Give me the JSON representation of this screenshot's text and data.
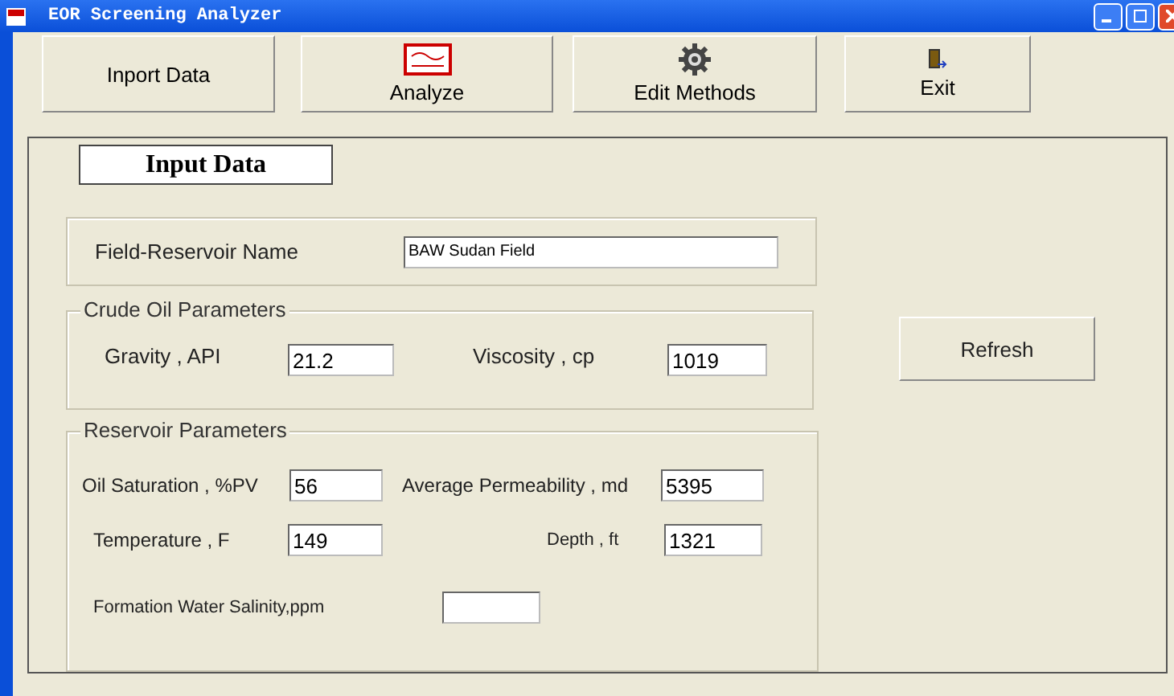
{
  "window": {
    "title": "EOR Screening Analyzer"
  },
  "toolbar": [
    {
      "label": "Inport  Data",
      "kind": "text"
    },
    {
      "label": "Analyze",
      "kind": "logo"
    },
    {
      "label": "Edit Methods",
      "kind": "gear"
    },
    {
      "label": "Exit",
      "kind": "door"
    }
  ],
  "heading": "Input Data",
  "field_reservoir": {
    "label": "Field-Reservoir Name",
    "value": "BAW Sudan Field"
  },
  "crude_oil": {
    "title": "Crude Oil Parameters",
    "fields": [
      {
        "label": "Gravity , API",
        "value": "21.2"
      },
      {
        "label": "Viscosity , cp",
        "value": "1019"
      }
    ]
  },
  "refresh_button": "Refresh",
  "reservoir": {
    "title": "Reservoir Parameters",
    "fields": [
      {
        "label": "Oil Saturation , %PV",
        "value": "56"
      },
      {
        "label": "Average Permeability , md",
        "value": "5395"
      },
      {
        "label": "Temperature , F",
        "value": "149"
      },
      {
        "label": "Depth , ft",
        "value": "1321"
      },
      {
        "label": "Formation Water Salinity,ppm"
      }
    ]
  }
}
